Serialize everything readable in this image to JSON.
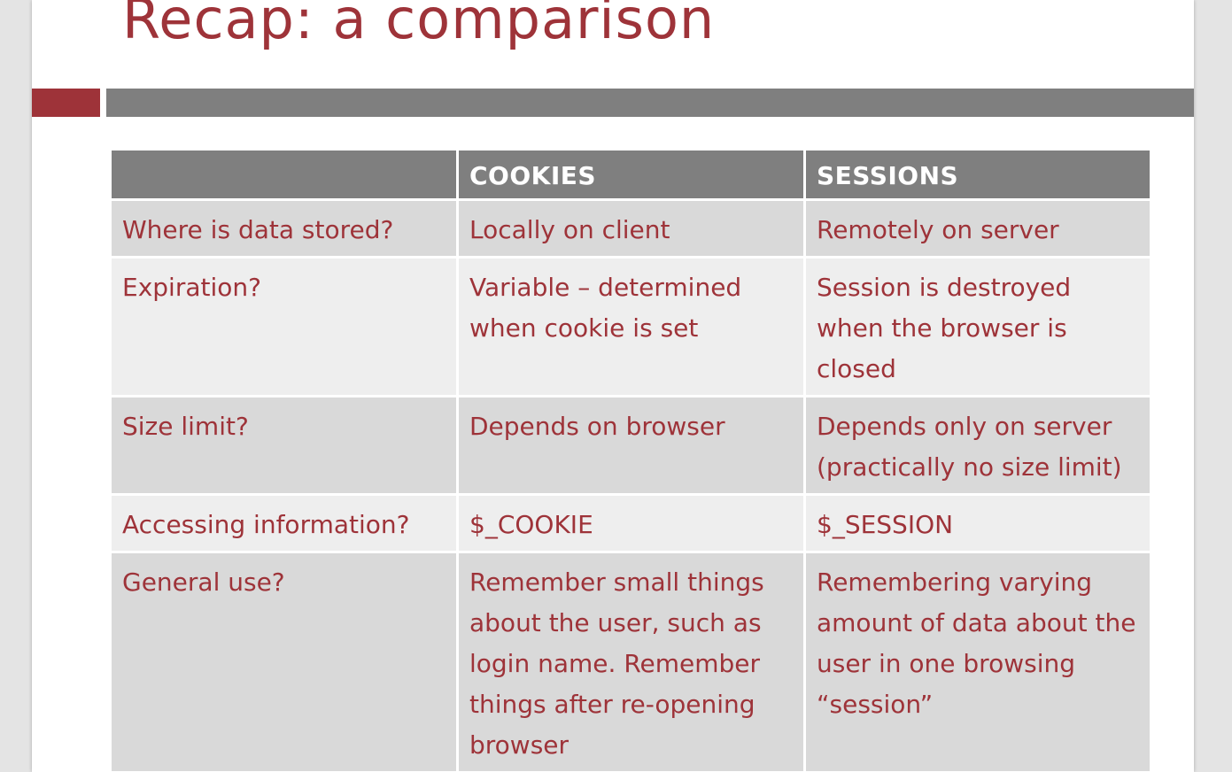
{
  "colors": {
    "accent": "#9e3339",
    "header_gray": "#7f7f7f",
    "text": "#9e3339"
  },
  "slide": {
    "title": "Recap: a comparison"
  },
  "table": {
    "headers": [
      "",
      "COOKIES",
      "SESSIONS"
    ],
    "rows": [
      [
        "Where is data stored?",
        "Locally on client",
        "Remotely on server"
      ],
      [
        "Expiration?",
        "Variable – determined when cookie is set",
        "Session is destroyed when the browser is closed"
      ],
      [
        "Size limit?",
        "Depends on browser",
        "Depends only on server (practically no size limit)"
      ],
      [
        "Accessing information?",
        "$_COOKIE",
        "$_SESSION"
      ],
      [
        "General use?",
        "Remember small things about the user, such as login name. Remember things after re-opening browser",
        "Remembering varying amount of data about the user in one browsing “session”"
      ]
    ]
  }
}
